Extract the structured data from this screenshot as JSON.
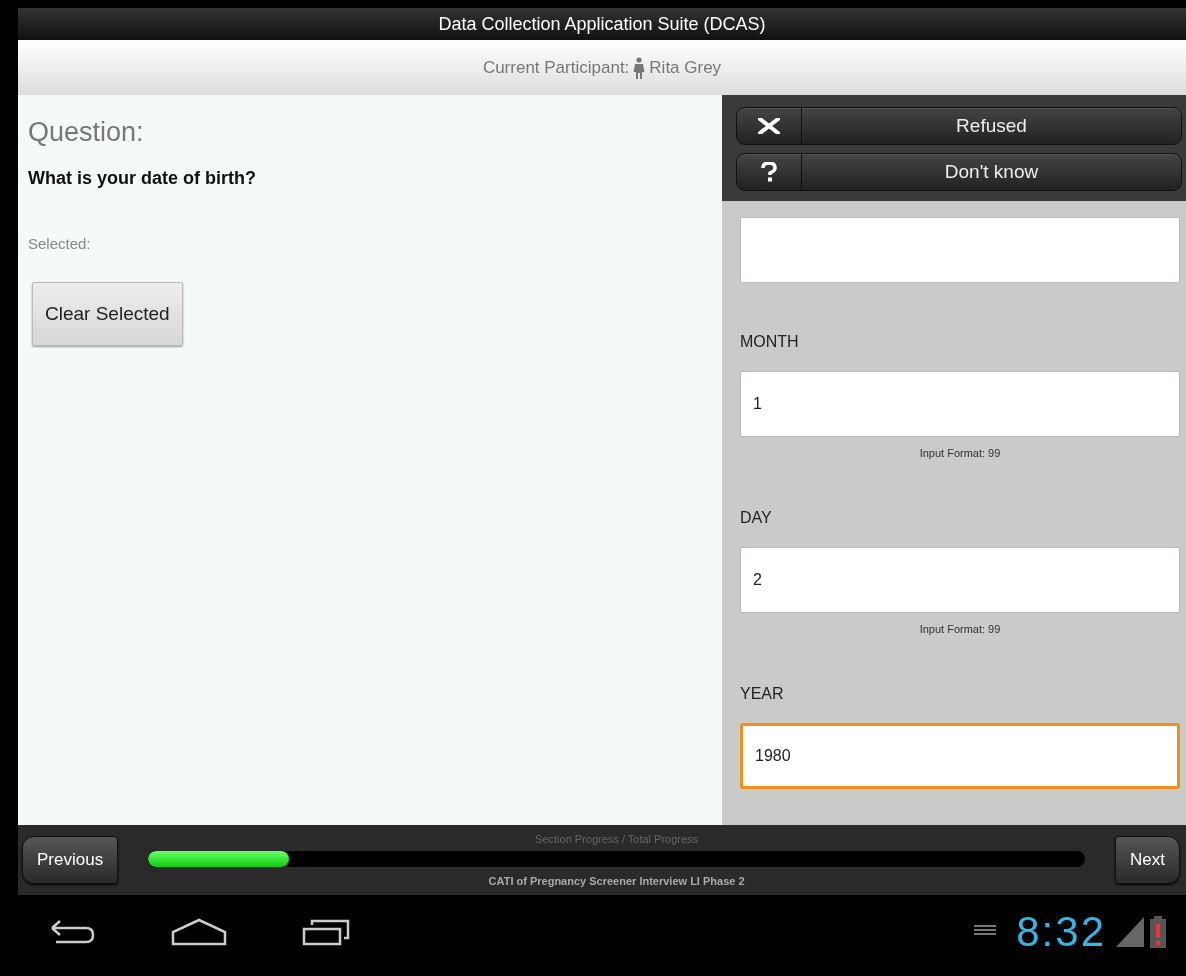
{
  "title_bar": {
    "title": "Data Collection Application Suite (DCAS)"
  },
  "participant_bar": {
    "label": "Current Participant:",
    "name": "Rita Grey"
  },
  "question": {
    "heading": "Question:",
    "text": "What is your date of birth?",
    "selected_label": "Selected:",
    "clear_button": "Clear Selected"
  },
  "special_answers": [
    {
      "kind": "refused",
      "label": "Refused"
    },
    {
      "kind": "unknown",
      "label": "Don't know"
    }
  ],
  "fields": [
    {
      "focused": false
    },
    {
      "label": "MONTH",
      "value": "1",
      "hint": "Input Format: 99",
      "focused": false
    },
    {
      "label": "DAY",
      "value": "2",
      "hint": "Input Format: 99",
      "focused": false
    },
    {
      "label": "YEAR",
      "value": "1980",
      "focused": true
    }
  ],
  "navigation": {
    "previous": "Previous",
    "next": "Next",
    "progress_label": "Section Progress / Total Progress",
    "level": 0.15,
    "survey_name": "CATI of Pregnancy Screener Interview LI Phase 2"
  },
  "system_bar": {
    "time": "8:32"
  }
}
